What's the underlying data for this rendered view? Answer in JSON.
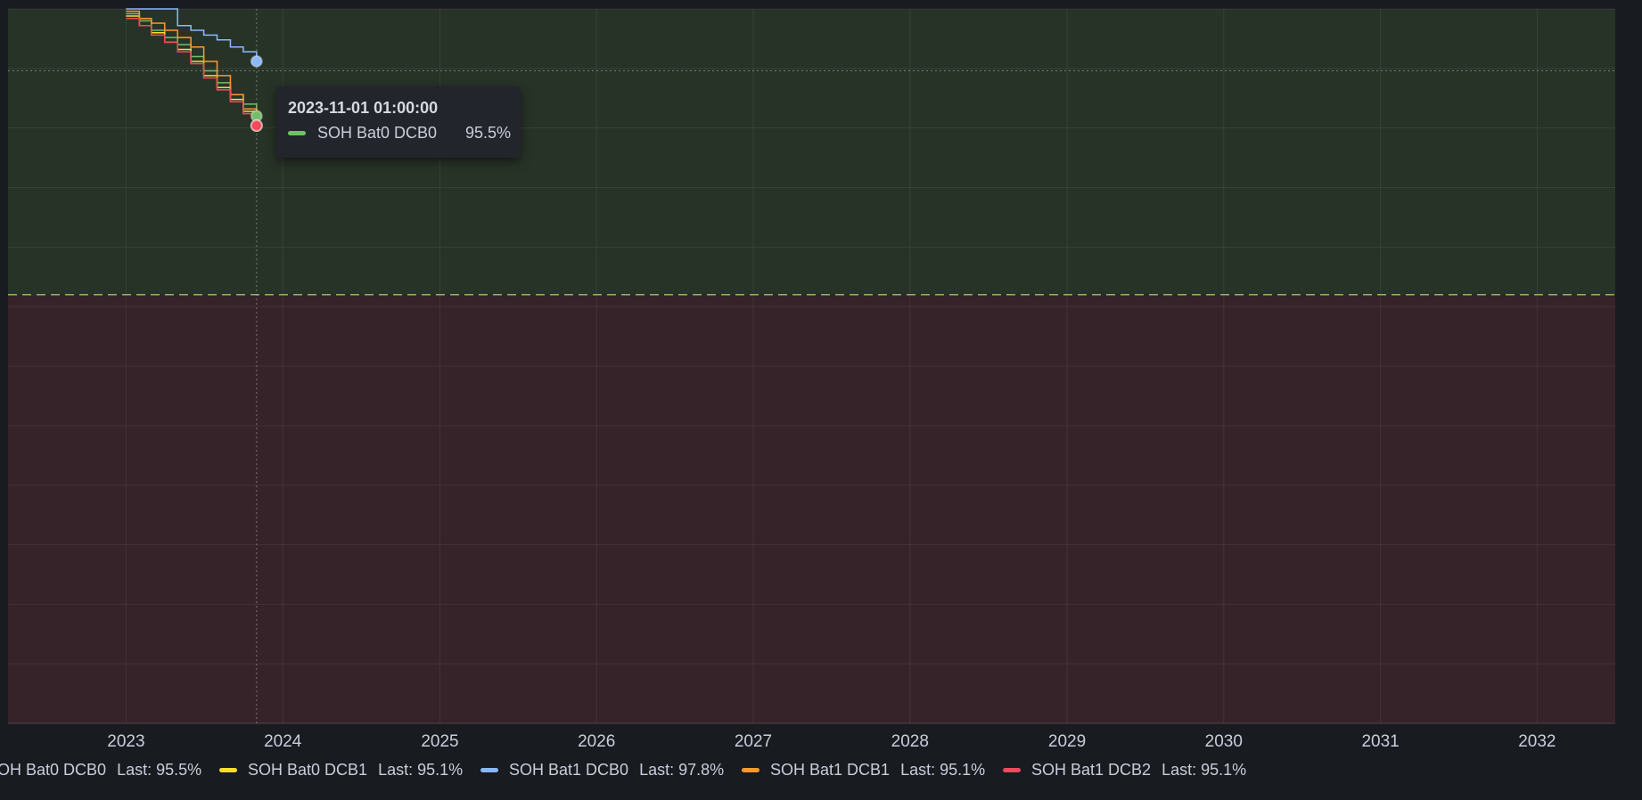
{
  "chart_data": {
    "type": "line",
    "xlim": [
      "2022-04-01",
      "2032-07-01"
    ],
    "ylim": [
      70,
      100
    ],
    "x_ticks": [
      "2023",
      "2024",
      "2025",
      "2026",
      "2027",
      "2028",
      "2029",
      "2030",
      "2031",
      "2032"
    ],
    "grid": true,
    "legend_position": "bottom",
    "threshold": {
      "value": 88,
      "above_color": "#283328",
      "below_color": "#362329",
      "line_color": "#8ab56a"
    },
    "hover_value": 97.4,
    "series": [
      {
        "name": "SOH Bat0 DCB0",
        "color": "#73bf69",
        "last": "Last: 95.5%",
        "points": [
          [
            "2023-01-01",
            99.8
          ],
          [
            "2023-02-01",
            99.5
          ],
          [
            "2023-03-01",
            99.1
          ],
          [
            "2023-04-01",
            98.8
          ],
          [
            "2023-05-01",
            98.5
          ],
          [
            "2023-06-01",
            98.0
          ],
          [
            "2023-07-01",
            97.4
          ],
          [
            "2023-08-01",
            96.9
          ],
          [
            "2023-09-01",
            96.4
          ],
          [
            "2023-10-01",
            96.0
          ],
          [
            "2023-11-01",
            95.5
          ]
        ]
      },
      {
        "name": "SOH Bat0 DCB1",
        "color": "#fade2a",
        "last": "Last: 95.1%",
        "points": [
          [
            "2023-01-01",
            99.7
          ],
          [
            "2023-02-01",
            99.3
          ],
          [
            "2023-03-01",
            99.0
          ],
          [
            "2023-04-01",
            98.6
          ],
          [
            "2023-05-01",
            98.3
          ],
          [
            "2023-06-01",
            97.8
          ],
          [
            "2023-07-01",
            97.2
          ],
          [
            "2023-08-01",
            96.7
          ],
          [
            "2023-09-01",
            96.2
          ],
          [
            "2023-10-01",
            95.7
          ],
          [
            "2023-11-01",
            95.1
          ]
        ]
      },
      {
        "name": "SOH Bat1 DCB0",
        "color": "#8ab8ff",
        "last": "Last: 97.8%",
        "points": [
          [
            "2023-01-01",
            100.0
          ],
          [
            "2023-04-01",
            100.0
          ],
          [
            "2023-05-01",
            99.3
          ],
          [
            "2023-06-01",
            99.1
          ],
          [
            "2023-07-01",
            98.9
          ],
          [
            "2023-08-01",
            98.7
          ],
          [
            "2023-09-01",
            98.4
          ],
          [
            "2023-10-01",
            98.2
          ],
          [
            "2023-11-01",
            97.8
          ]
        ]
      },
      {
        "name": "SOH Bat1 DCB1",
        "color": "#ff9830",
        "last": "Last: 95.1%",
        "points": [
          [
            "2023-01-01",
            99.9
          ],
          [
            "2023-02-01",
            99.6
          ],
          [
            "2023-03-01",
            99.4
          ],
          [
            "2023-04-01",
            99.1
          ],
          [
            "2023-05-01",
            98.8
          ],
          [
            "2023-06-01",
            98.4
          ],
          [
            "2023-07-01",
            97.8
          ],
          [
            "2023-08-01",
            97.2
          ],
          [
            "2023-09-01",
            96.4
          ],
          [
            "2023-10-01",
            95.8
          ],
          [
            "2023-11-01",
            95.1
          ]
        ]
      },
      {
        "name": "SOH Bat1 DCB2",
        "color": "#f2495c",
        "last": "Last: 95.1%",
        "points": [
          [
            "2023-01-01",
            99.6
          ],
          [
            "2023-02-01",
            99.3
          ],
          [
            "2023-03-01",
            98.9
          ],
          [
            "2023-04-01",
            98.6
          ],
          [
            "2023-05-01",
            98.2
          ],
          [
            "2023-06-01",
            97.7
          ],
          [
            "2023-07-01",
            97.1
          ],
          [
            "2023-08-01",
            96.6
          ],
          [
            "2023-09-01",
            96.1
          ],
          [
            "2023-10-01",
            95.6
          ],
          [
            "2023-11-01",
            95.1
          ]
        ]
      }
    ],
    "tooltip": {
      "time": "2023-11-01 01:00:00",
      "series": "SOH Bat0 DCB0",
      "value": "95.5%",
      "color": "#73bf69"
    }
  }
}
